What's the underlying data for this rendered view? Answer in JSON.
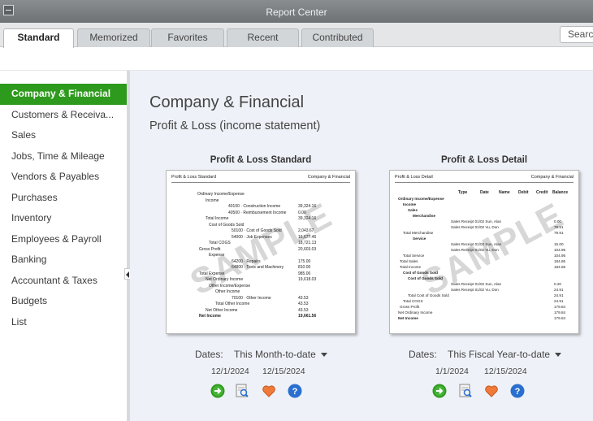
{
  "window": {
    "title": "Report Center"
  },
  "tabs": [
    {
      "label": "Standard",
      "active": true
    },
    {
      "label": "Memorized",
      "active": false
    },
    {
      "label": "Favorites",
      "active": false
    },
    {
      "label": "Recent",
      "active": false
    },
    {
      "label": "Contributed",
      "active": false
    }
  ],
  "search": {
    "text": "Search"
  },
  "sidebar": {
    "items": [
      {
        "label": "Company & Financial",
        "active": true
      },
      {
        "label": "Customers & Receiva..."
      },
      {
        "label": "Sales"
      },
      {
        "label": "Jobs, Time & Mileage"
      },
      {
        "label": "Vendors & Payables"
      },
      {
        "label": "Purchases"
      },
      {
        "label": "Inventory"
      },
      {
        "label": "Employees & Payroll"
      },
      {
        "label": "Banking"
      },
      {
        "label": "Accountant & Taxes"
      },
      {
        "label": "Budgets"
      },
      {
        "label": "List"
      }
    ]
  },
  "main": {
    "heading": "Company & Financial",
    "subheading": "Profit & Loss (income statement)",
    "cards": [
      {
        "title": "Profit & Loss Standard",
        "thumb_left": "Profit & Loss Standard",
        "thumb_right": "Company & Financial",
        "watermark": "SAMPLE",
        "rows": [
          {
            "label": "Ordinary Income/Expense",
            "value": ""
          },
          {
            "label": "Income",
            "value": ""
          },
          {
            "label": "40100 · Construction Income",
            "value": "39,324.16"
          },
          {
            "label": "40500 · Reimbursement Income",
            "value": "0.00"
          },
          {
            "label": "Total Income",
            "value": "39,324.16"
          },
          {
            "label": "Cost of Goods Sold",
            "value": ""
          },
          {
            "label": "50100 · Cost of Goods Sold",
            "value": "2,043.67"
          },
          {
            "label": "54000 · Job Expenses",
            "value": "16,677.46"
          },
          {
            "label": "Total COGS",
            "value": "18,721.13"
          },
          {
            "label": "Gross Profit",
            "value": "20,603.03"
          },
          {
            "label": "Expense",
            "value": ""
          },
          {
            "label": "64200 · Repairs",
            "value": "175.00"
          },
          {
            "label": "64800 · Tools and Machinery",
            "value": "810.00"
          },
          {
            "label": "Total Expense",
            "value": "985.00"
          },
          {
            "label": "Net Ordinary Income",
            "value": "19,618.03"
          },
          {
            "label": "Other Income/Expense",
            "value": ""
          },
          {
            "label": "Other Income",
            "value": ""
          },
          {
            "label": "70100 · Other Income",
            "value": "43.53"
          },
          {
            "label": "Total Other Income",
            "value": "43.53"
          },
          {
            "label": "Net Other Income",
            "value": "43.53"
          },
          {
            "label": "Net Income",
            "value": "19,661.56"
          }
        ],
        "dates_label": "Dates:",
        "range": "This Month-to-date",
        "from": "12/1/2024",
        "to": "12/15/2024"
      },
      {
        "title": "Profit & Loss Detail",
        "thumb_left": "Profit & Loss Detail",
        "thumb_right": "Company & Financial",
        "watermark": "SAMPLE",
        "columns": [
          "Type",
          "Date",
          "Name",
          "Debit",
          "Credit",
          "Balance"
        ],
        "rows": [
          {
            "label": "Ordinary Income/Expense"
          },
          {
            "label": "Income"
          },
          {
            "label": "Sales"
          },
          {
            "label": "Merchandise"
          },
          {
            "label": "Sales Receipt  01/02  Sun, Alan",
            "value": "0.00"
          },
          {
            "label": "Sales Receipt  01/02  Vu, Don",
            "value": "79.91"
          },
          {
            "label": "Total Merchandise",
            "value": "79.91"
          },
          {
            "label": "Service"
          },
          {
            "label": "Sales Receipt  01/02  Sun, Alan",
            "value": "15.00"
          },
          {
            "label": "Sales Receipt  01/02  Vu, Don",
            "value": "104.95"
          },
          {
            "label": "Total Service",
            "value": "104.95"
          },
          {
            "label": "Total Sales",
            "value": "184.86"
          },
          {
            "label": "Total Income",
            "value": "184.86"
          },
          {
            "label": "Cost of Goods Sold"
          },
          {
            "label": "Cost of Goods Sold"
          },
          {
            "label": "Sales Receipt  01/02  Sun, Alan",
            "value": "0.20"
          },
          {
            "label": "Sales Receipt  01/02  Vu, Don",
            "value": "24.91"
          },
          {
            "label": "Total Cost of Goods Sold",
            "value": "24.91"
          },
          {
            "label": "Total COGS",
            "value": "24.91"
          },
          {
            "label": "Gross Profit",
            "value": "179.84"
          },
          {
            "label": "Net Ordinary Income",
            "value": "179.84"
          },
          {
            "label": "Net Income",
            "value": "179.84"
          }
        ],
        "dates_label": "Dates:",
        "range": "This Fiscal Year-to-date",
        "from": "1/1/2024",
        "to": "12/15/2024"
      }
    ]
  },
  "icons": [
    "run-report-icon",
    "preview-icon",
    "favorite-heart-icon",
    "help-icon"
  ],
  "colors": {
    "accent_green": "#2e9a1d",
    "help_blue": "#2a6fcf",
    "heart_orange": "#ef7a3a"
  }
}
